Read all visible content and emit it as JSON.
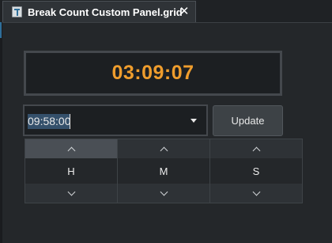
{
  "tab": {
    "title": "Break Count Custom Panel.grid",
    "close_label": "✕"
  },
  "display": {
    "time": "03:09:07"
  },
  "time_input": {
    "value": "09:58:00"
  },
  "update_button": {
    "label": "Update"
  },
  "spinners": {
    "hours": "H",
    "minutes": "M",
    "seconds": "S"
  },
  "colors": {
    "display_text": "#ef9d2d",
    "background": "#24272a",
    "selection": "#34506b"
  },
  "icons": {
    "tab": "grid-file-icon",
    "close": "close-icon",
    "dropdown": "chevron-down-icon",
    "increment": "chevron-up-icon",
    "decrement": "chevron-down-icon"
  }
}
